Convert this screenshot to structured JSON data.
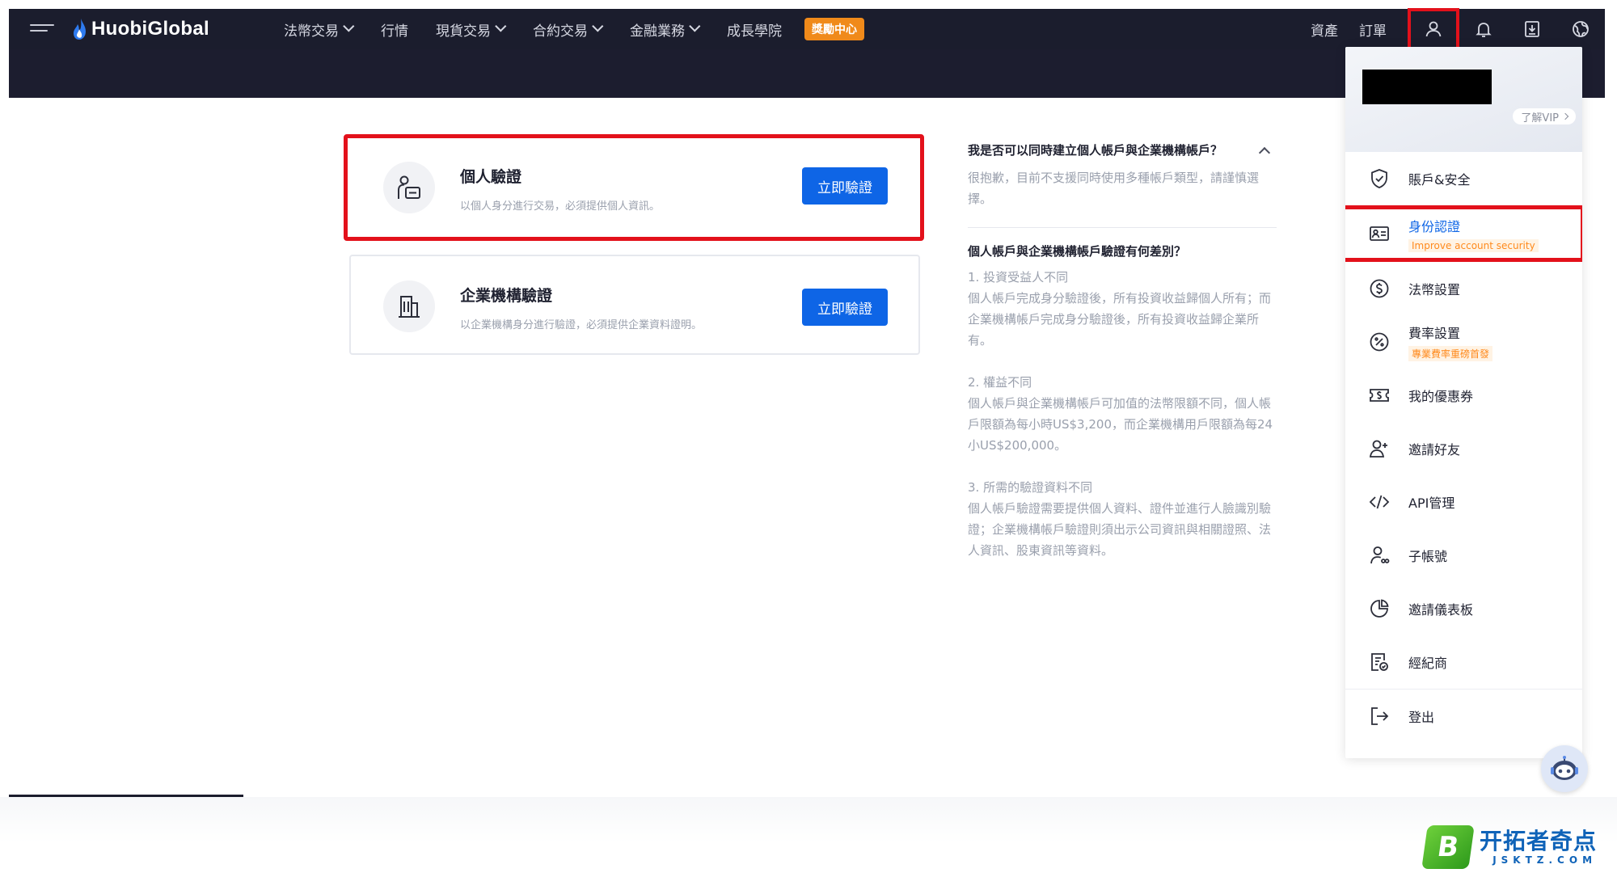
{
  "nav": {
    "brand": "HuobiGlobal",
    "items": [
      {
        "label": "法幣交易",
        "dropdown": true
      },
      {
        "label": "行情",
        "dropdown": false
      },
      {
        "label": "現貨交易",
        "dropdown": true
      },
      {
        "label": "合約交易",
        "dropdown": true
      },
      {
        "label": "金融業務",
        "dropdown": true
      },
      {
        "label": "成長學院",
        "dropdown": false
      }
    ],
    "rewards_center": "獎勵中心",
    "assets": "資產",
    "orders": "訂單",
    "right_icons": [
      "user-icon",
      "bell-icon",
      "download-icon",
      "globe-icon"
    ]
  },
  "cards": [
    {
      "title": "個人驗證",
      "desc": "以個人身分進行交易，必須提供個人資訊。",
      "button": "立即驗證"
    },
    {
      "title": "企業機構驗證",
      "desc": "以企業機構身分進行驗證，必須提供企業資料證明。",
      "button": "立即驗證"
    }
  ],
  "faq": {
    "q1": "我是否可以同時建立個人帳戶與企業機構帳戶？",
    "a1": "很抱歉，目前不支援同時使用多種帳戶類型，請謹慎選擇。",
    "q2": "個人帳戶與企業機構帳戶驗證有何差別？",
    "diffs": [
      {
        "heading": "1. 投資受益人不同",
        "body": "個人帳戶完成身分驗證後，所有投資收益歸個人所有；而企業機構帳戶完成身分驗證後，所有投資收益歸企業所有。"
      },
      {
        "heading": "2. 權益不同",
        "body": "個人帳戶與企業機構帳戶可加值的法幣限額不同，個人帳戶限額為每小時US$3,200，而企業機構用戶限額為每24小US$200,000。"
      },
      {
        "heading": "3. 所需的驗證資料不同",
        "body": "個人帳戶驗證需要提供個人資料、證件並進行人臉識別驗證；企業機構帳戶驗證則須出示公司資訊與相關證照、法人資訊、股東資訊等資料。"
      }
    ]
  },
  "dropdown": {
    "vip": "了解VIP",
    "items": [
      {
        "label": "賬戶&安全",
        "icon": "shield-icon"
      },
      {
        "label": "身份認證",
        "icon": "id-card-icon",
        "tag": "Improve account security",
        "active": true
      },
      {
        "label": "法幣設置",
        "icon": "dollar-circle-icon"
      },
      {
        "label": "費率設置",
        "icon": "percent-icon",
        "tag": "專業費率重磅首發"
      },
      {
        "label": "我的優惠券",
        "icon": "coupon-icon"
      },
      {
        "label": "邀請好友",
        "icon": "add-user-icon"
      },
      {
        "label": "API管理",
        "icon": "code-icon"
      },
      {
        "label": "子帳號",
        "icon": "sub-account-icon"
      },
      {
        "label": "邀請儀表板",
        "icon": "pie-chart-icon"
      },
      {
        "label": "經紀商",
        "icon": "broker-icon"
      },
      {
        "label": "登出",
        "icon": "logout-icon"
      }
    ]
  },
  "watermark": {
    "letter": "B",
    "cn": "开拓者奇点",
    "en": "JSKTZ.COM"
  }
}
